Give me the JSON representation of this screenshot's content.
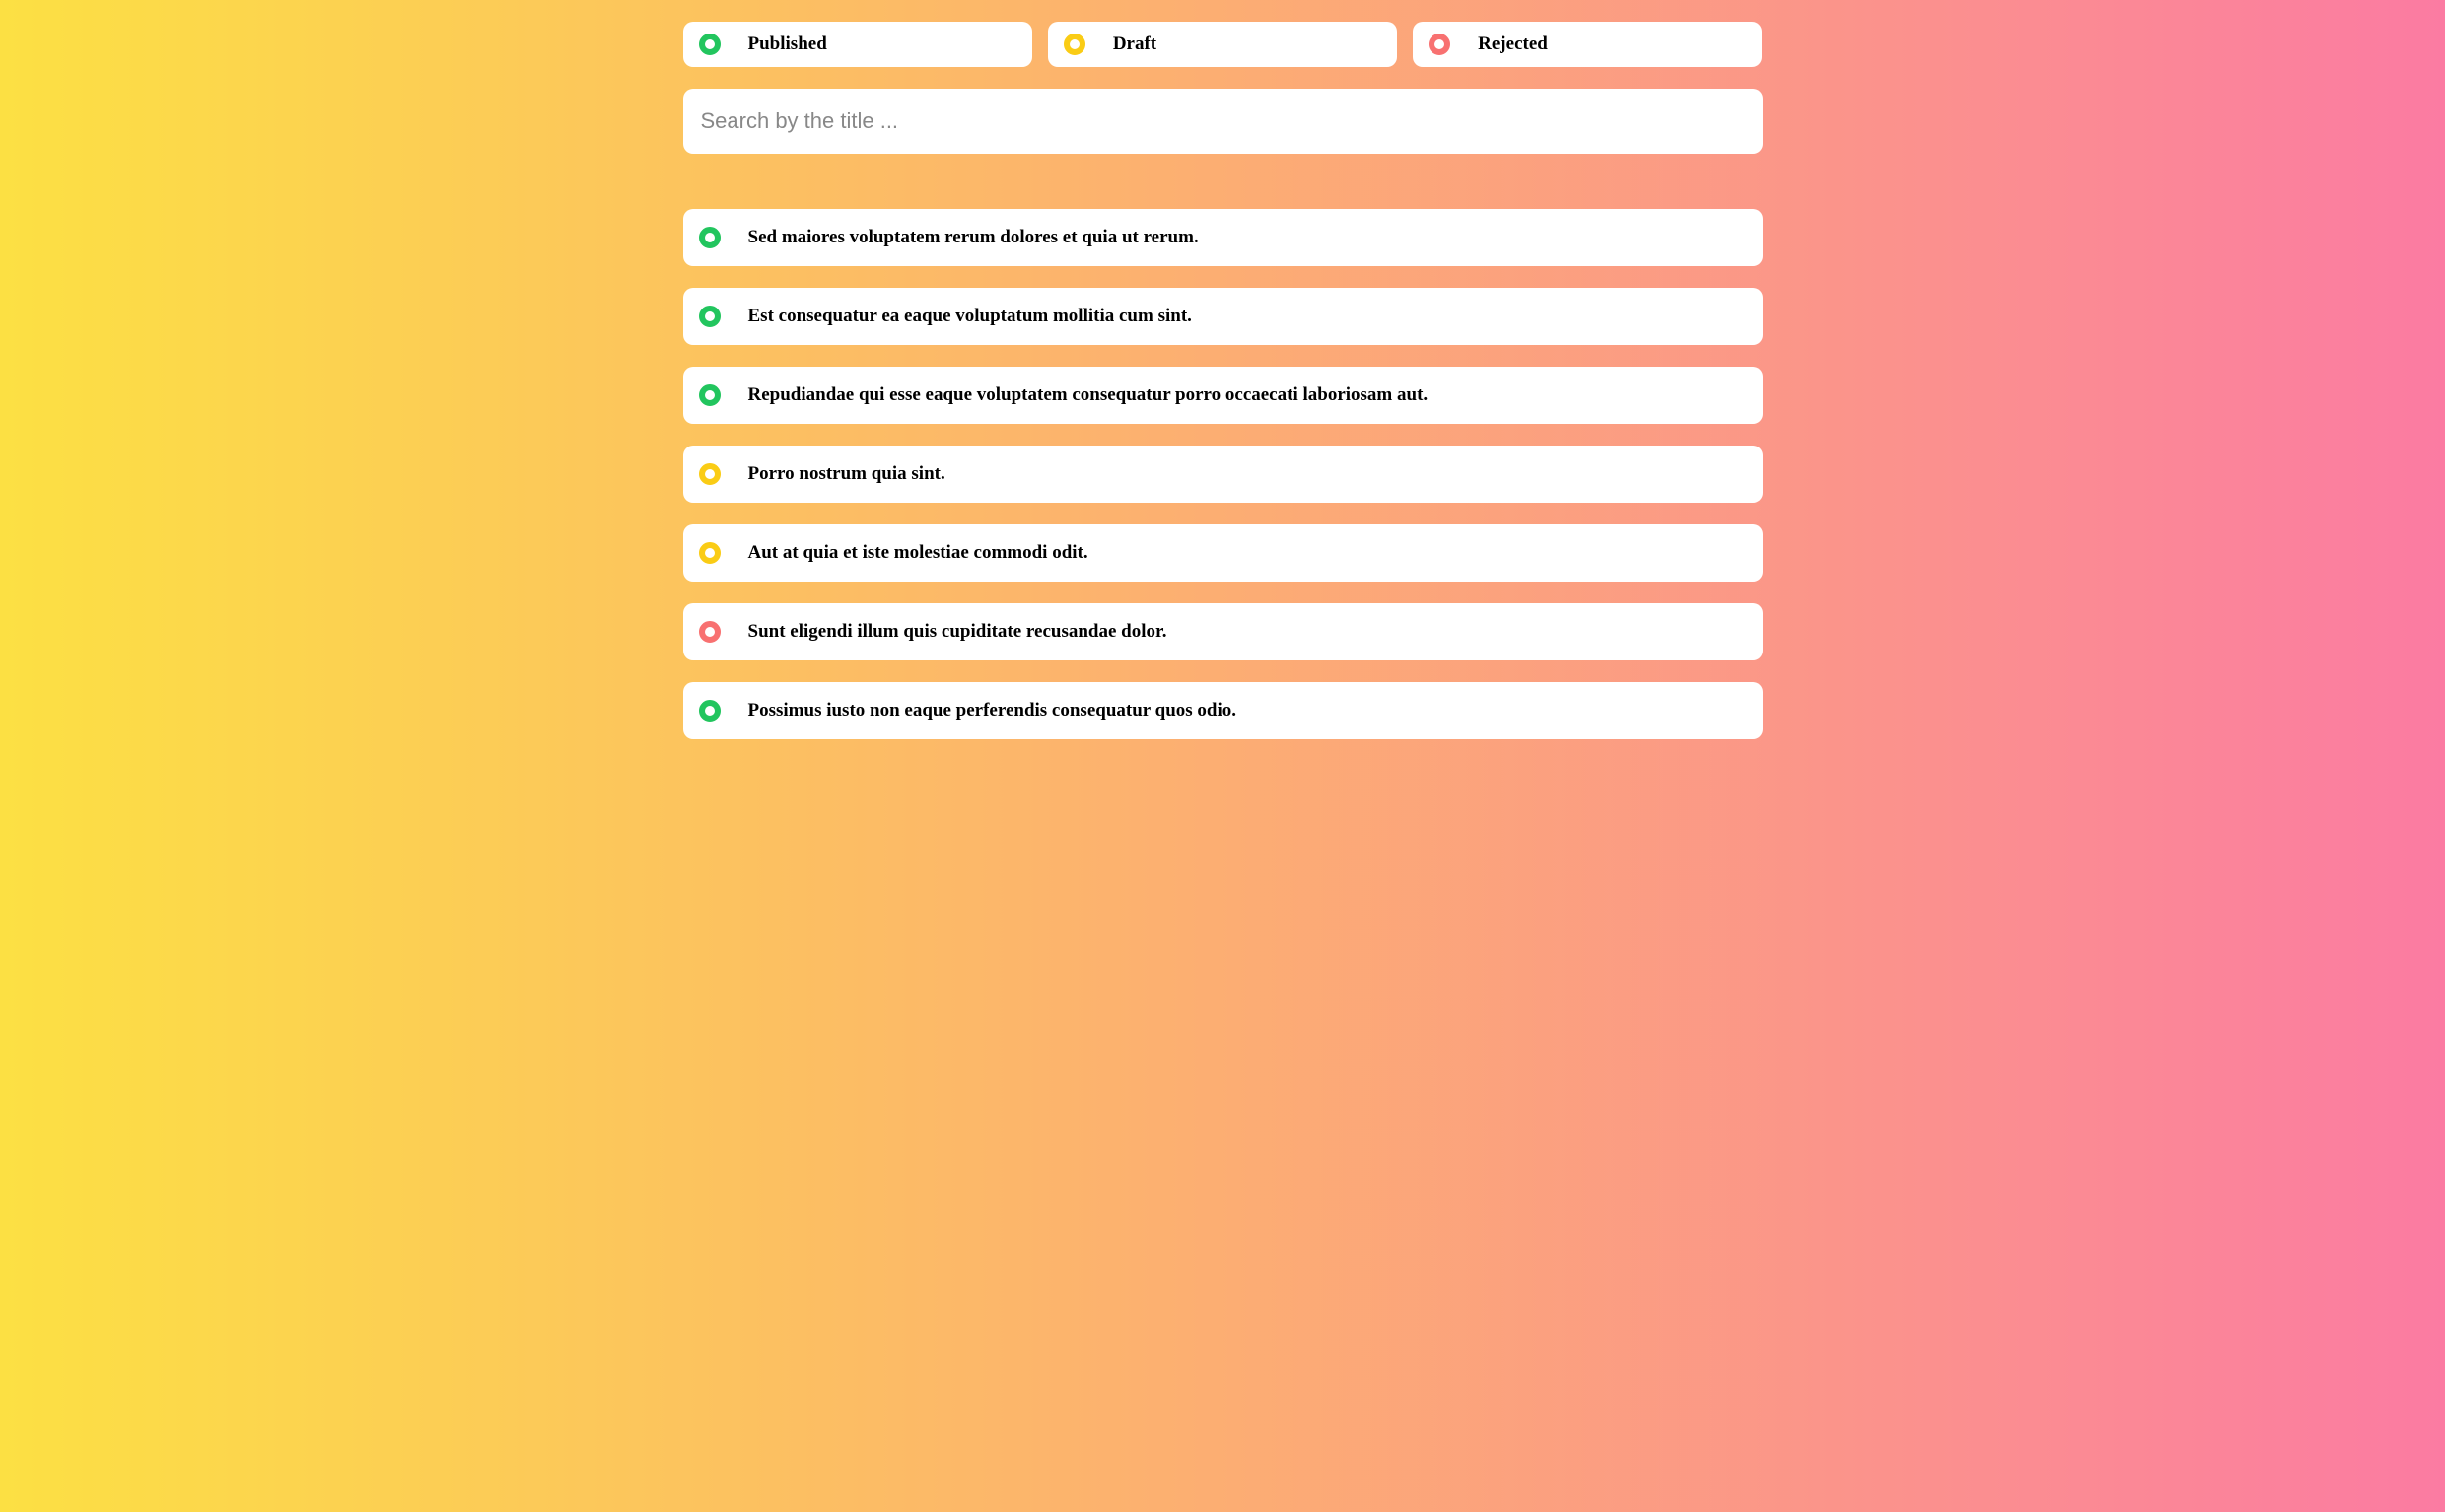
{
  "filters": [
    {
      "label": "Published",
      "status": "green"
    },
    {
      "label": "Draft",
      "status": "yellow"
    },
    {
      "label": "Rejected",
      "status": "red"
    }
  ],
  "search": {
    "placeholder": "Search by the title ...",
    "value": ""
  },
  "items": [
    {
      "title": "Sed maiores voluptatem rerum dolores et quia ut rerum.",
      "status": "green"
    },
    {
      "title": "Est consequatur ea eaque voluptatum mollitia cum sint.",
      "status": "green"
    },
    {
      "title": "Repudiandae qui esse eaque voluptatem consequatur porro occaecati laboriosam aut.",
      "status": "green"
    },
    {
      "title": "Porro nostrum quia sint.",
      "status": "yellow"
    },
    {
      "title": "Aut at quia et iste molestiae commodi odit.",
      "status": "yellow"
    },
    {
      "title": "Sunt eligendi illum quis cupiditate recusandae dolor.",
      "status": "red"
    },
    {
      "title": "Possimus iusto non eaque perferendis consequatur quos odio.",
      "status": "green"
    }
  ],
  "colors": {
    "green": "#22C55E",
    "yellow": "#FACC15",
    "red": "#F87171"
  }
}
